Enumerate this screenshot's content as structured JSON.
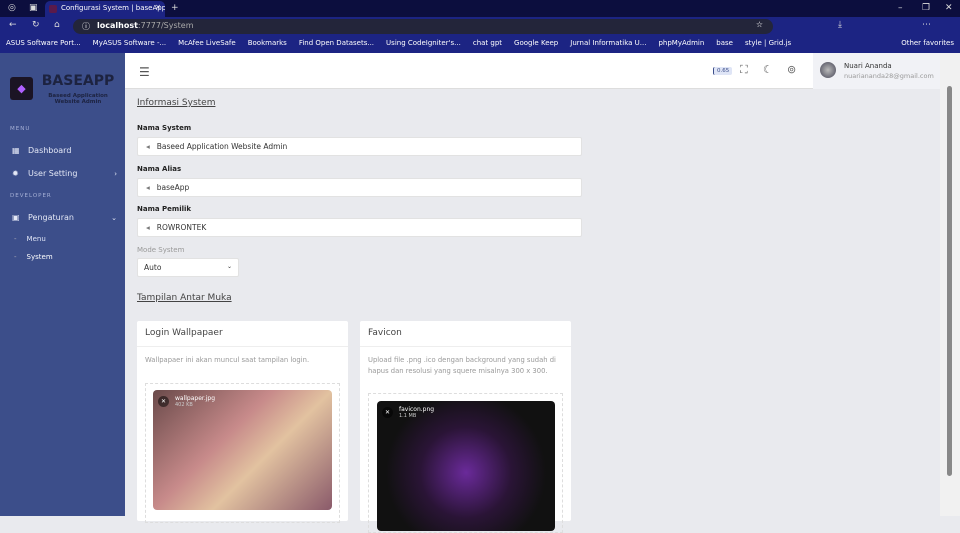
{
  "browser": {
    "tab_title": "Configurasi System | baseApp - B",
    "url_host": "localhost",
    "url_path": ":7777/System",
    "bookmarks": [
      "ASUS Software Port...",
      "MyASUS Software -...",
      "McAfee LiveSafe",
      "Bookmarks",
      "Find Open Datasets...",
      "Using CodeIgniter's...",
      "chat gpt",
      "Google Keep",
      "Jurnal Informatika U...",
      "phpMyAdmin",
      "base",
      "style | Grid.js"
    ],
    "other_favorites": "Other favorites"
  },
  "sidebar": {
    "brand": "BASEAPP",
    "brand_sub": "Baseed Application Website Admin",
    "section_menu": "MENU",
    "section_dev": "DEVELOPER",
    "items": [
      {
        "label": "Dashboard"
      },
      {
        "label": "User Setting"
      },
      {
        "label": "Pengaturan"
      }
    ],
    "subitems": [
      {
        "label": "Menu"
      },
      {
        "label": "System"
      }
    ]
  },
  "header": {
    "version": "0.65",
    "user_name": "Nuari Ananda",
    "user_email": "nuariananda28@gmail.com"
  },
  "main": {
    "section1": "Informasi System",
    "fields": [
      {
        "label": "Nama System",
        "value": "Baseed Application Website Admin"
      },
      {
        "label": "Nama Alias",
        "value": "baseApp"
      },
      {
        "label": "Nama Pemilik",
        "value": "ROWRONTEK"
      }
    ],
    "mode_label": "Mode System",
    "mode_value": "Auto",
    "section2": "Tampilan Antar Muka",
    "cards": [
      {
        "title": "Login Wallpapaer",
        "desc": "Wallpapaer ini akan muncul saat tampilan login.",
        "file": "wallpaper.jpg",
        "size": "402 KB"
      },
      {
        "title": "Favicon",
        "desc": "Upload file .png .ico dengan background yang sudah di hapus dan resolusi yang squere misalnya 300 x 300.",
        "file": "favicon.png",
        "size": "1.1 MB"
      }
    ]
  }
}
